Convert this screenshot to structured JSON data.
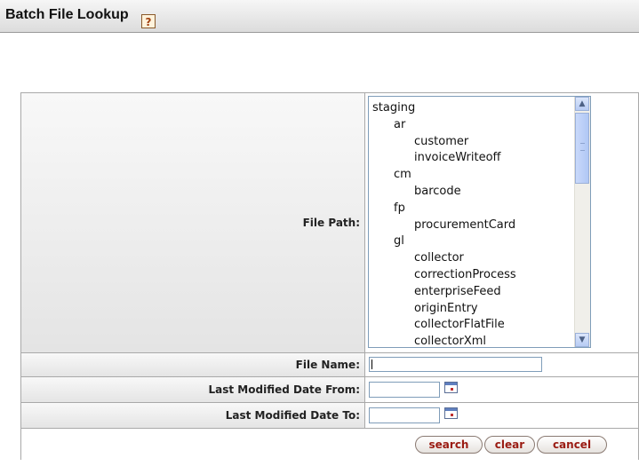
{
  "header": {
    "title": "Batch File Lookup",
    "help_icon": "help-icon"
  },
  "form": {
    "file_path": {
      "label": "File Path:",
      "tree": [
        {
          "text": "staging",
          "level": 0
        },
        {
          "text": "ar",
          "level": 1
        },
        {
          "text": "customer",
          "level": 2
        },
        {
          "text": "invoiceWriteoff",
          "level": 2
        },
        {
          "text": "cm",
          "level": 1
        },
        {
          "text": "barcode",
          "level": 2
        },
        {
          "text": "fp",
          "level": 1
        },
        {
          "text": "procurementCard",
          "level": 2
        },
        {
          "text": "gl",
          "level": 1
        },
        {
          "text": "collector",
          "level": 2
        },
        {
          "text": "correctionProcess",
          "level": 2
        },
        {
          "text": "enterpriseFeed",
          "level": 2
        },
        {
          "text": "originEntry",
          "level": 2
        },
        {
          "text": "collectorFlatFile",
          "level": 2
        },
        {
          "text": "collectorXml",
          "level": 2
        }
      ]
    },
    "file_name": {
      "label": "File Name:",
      "value": ""
    },
    "date_from": {
      "label": "Last Modified Date From:",
      "value": "",
      "icon": "calendar-icon"
    },
    "date_to": {
      "label": "Last Modified Date To:",
      "value": "",
      "icon": "calendar-icon"
    }
  },
  "buttons": {
    "search": "search",
    "clear": "clear",
    "cancel": "cancel"
  },
  "colors": {
    "button_text": "#9a1b12",
    "header_bg": "#dcdcdc",
    "label_bg": "#e4e4e4"
  }
}
